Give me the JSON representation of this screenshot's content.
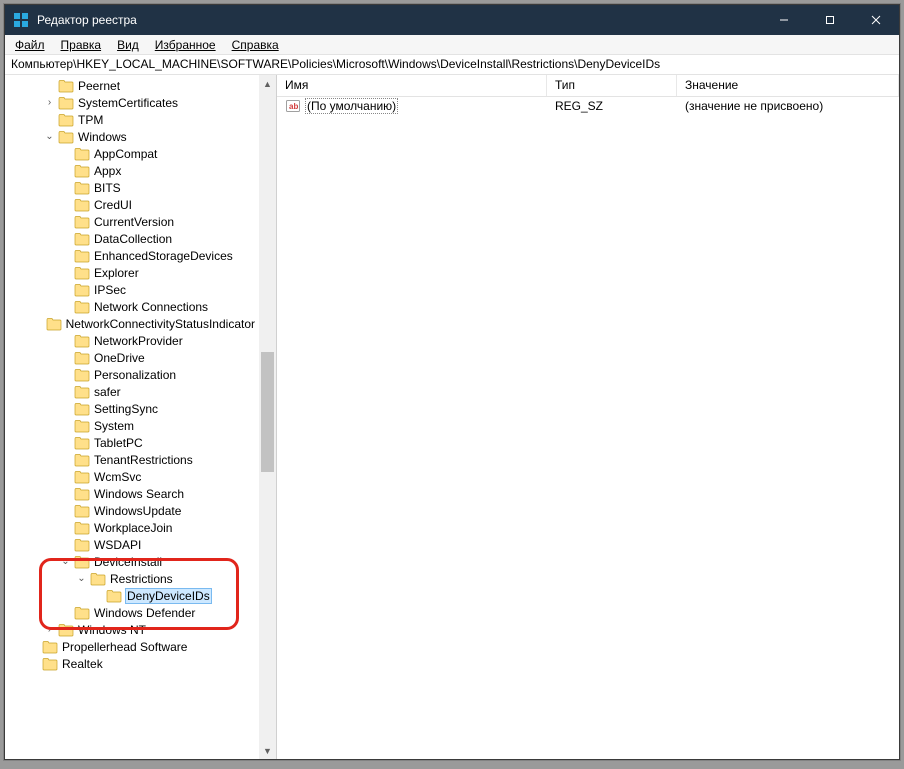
{
  "window": {
    "title": "Редактор реестра"
  },
  "menu": {
    "file": "Файл",
    "edit": "Правка",
    "view": "Вид",
    "favorites": "Избранное",
    "help": "Справка"
  },
  "address": "Компьютер\\HKEY_LOCAL_MACHINE\\SOFTWARE\\Policies\\Microsoft\\Windows\\DeviceInstall\\Restrictions\\DenyDeviceIDs",
  "columns": {
    "name": "Имя",
    "type": "Тип",
    "data": "Значение"
  },
  "values": [
    {
      "name": "(По умолчанию)",
      "type": "REG_SZ",
      "data": "(значение не присвоено)"
    }
  ],
  "tree": [
    {
      "depth": 2,
      "twisty": "none",
      "label": "Peernet"
    },
    {
      "depth": 2,
      "twisty": "closed",
      "label": "SystemCertificates"
    },
    {
      "depth": 2,
      "twisty": "none",
      "label": "TPM"
    },
    {
      "depth": 2,
      "twisty": "open",
      "label": "Windows"
    },
    {
      "depth": 3,
      "twisty": "none",
      "label": "AppCompat"
    },
    {
      "depth": 3,
      "twisty": "none",
      "label": "Appx"
    },
    {
      "depth": 3,
      "twisty": "none",
      "label": "BITS"
    },
    {
      "depth": 3,
      "twisty": "none",
      "label": "CredUI"
    },
    {
      "depth": 3,
      "twisty": "none",
      "label": "CurrentVersion"
    },
    {
      "depth": 3,
      "twisty": "none",
      "label": "DataCollection"
    },
    {
      "depth": 3,
      "twisty": "none",
      "label": "EnhancedStorageDevices"
    },
    {
      "depth": 3,
      "twisty": "none",
      "label": "Explorer"
    },
    {
      "depth": 3,
      "twisty": "none",
      "label": "IPSec"
    },
    {
      "depth": 3,
      "twisty": "none",
      "label": "Network Connections"
    },
    {
      "depth": 3,
      "twisty": "none",
      "label": "NetworkConnectivityStatusIndicator"
    },
    {
      "depth": 3,
      "twisty": "none",
      "label": "NetworkProvider"
    },
    {
      "depth": 3,
      "twisty": "none",
      "label": "OneDrive"
    },
    {
      "depth": 3,
      "twisty": "none",
      "label": "Personalization"
    },
    {
      "depth": 3,
      "twisty": "none",
      "label": "safer"
    },
    {
      "depth": 3,
      "twisty": "none",
      "label": "SettingSync"
    },
    {
      "depth": 3,
      "twisty": "none",
      "label": "System"
    },
    {
      "depth": 3,
      "twisty": "none",
      "label": "TabletPC"
    },
    {
      "depth": 3,
      "twisty": "none",
      "label": "TenantRestrictions"
    },
    {
      "depth": 3,
      "twisty": "none",
      "label": "WcmSvc"
    },
    {
      "depth": 3,
      "twisty": "none",
      "label": "Windows Search"
    },
    {
      "depth": 3,
      "twisty": "none",
      "label": "WindowsUpdate"
    },
    {
      "depth": 3,
      "twisty": "none",
      "label": "WorkplaceJoin"
    },
    {
      "depth": 3,
      "twisty": "none",
      "label": "WSDAPI"
    },
    {
      "depth": 3,
      "twisty": "open",
      "label": "DeviceInstall"
    },
    {
      "depth": 4,
      "twisty": "open",
      "label": "Restrictions"
    },
    {
      "depth": 5,
      "twisty": "none",
      "label": "DenyDeviceIDs",
      "selected": true
    },
    {
      "depth": 3,
      "twisty": "none",
      "label": "Windows Defender"
    },
    {
      "depth": 2,
      "twisty": "closed",
      "label": "Windows NT"
    },
    {
      "depth": 1,
      "twisty": "none",
      "label": "Propellerhead Software"
    },
    {
      "depth": 1,
      "twisty": "closed-cut",
      "label": "Realtek"
    }
  ]
}
